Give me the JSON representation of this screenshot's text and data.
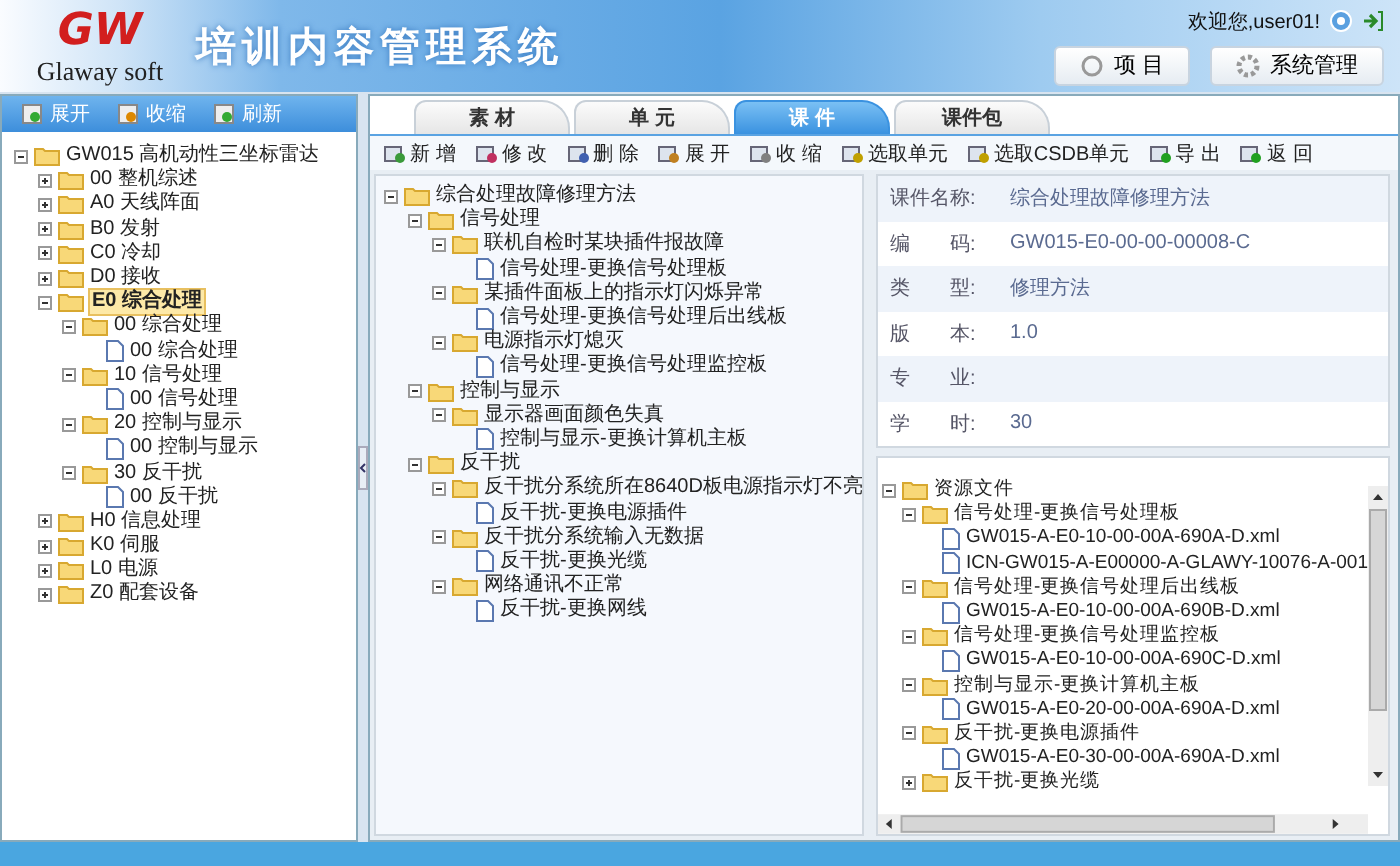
{
  "header": {
    "logo_mark": "GW",
    "logo_text": "Glaway soft",
    "title": "培训内容管理系统",
    "welcome": "欢迎您,user01!",
    "buttons": [
      "项 目",
      "系统管理"
    ]
  },
  "left_toolbar": [
    "展开",
    "收缩",
    "刷新"
  ],
  "left_tree": [
    {
      "label": "GW015 高机动性三坐标雷达",
      "kind": "folder",
      "expanded": true,
      "selected": false,
      "children": [
        {
          "label": "00 整机综述",
          "kind": "folder",
          "expanded": false,
          "selected": false
        },
        {
          "label": "A0 天线阵面",
          "kind": "folder",
          "expanded": false,
          "selected": false
        },
        {
          "label": "B0 发射",
          "kind": "folder",
          "expanded": false,
          "selected": false
        },
        {
          "label": "C0 冷却",
          "kind": "folder",
          "expanded": false,
          "selected": false
        },
        {
          "label": "D0 接收",
          "kind": "folder",
          "expanded": false,
          "selected": false
        },
        {
          "label": "E0 综合处理",
          "kind": "folder",
          "expanded": true,
          "selected": true,
          "children": [
            {
              "label": "00 综合处理",
              "kind": "folder",
              "expanded": true,
              "selected": false,
              "children": [
                {
                  "label": "00 综合处理",
                  "kind": "file",
                  "selected": false
                }
              ]
            },
            {
              "label": "10 信号处理",
              "kind": "folder",
              "expanded": true,
              "selected": false,
              "children": [
                {
                  "label": "00 信号处理",
                  "kind": "file",
                  "selected": false
                }
              ]
            },
            {
              "label": "20 控制与显示",
              "kind": "folder",
              "expanded": true,
              "selected": false,
              "children": [
                {
                  "label": "00 控制与显示",
                  "kind": "file",
                  "selected": false
                }
              ]
            },
            {
              "label": "30 反干扰",
              "kind": "folder",
              "expanded": true,
              "selected": false,
              "children": [
                {
                  "label": "00 反干扰",
                  "kind": "file",
                  "selected": false
                }
              ]
            }
          ]
        },
        {
          "label": "H0 信息处理",
          "kind": "folder",
          "expanded": false,
          "selected": false
        },
        {
          "label": "K0 伺服",
          "kind": "folder",
          "expanded": false,
          "selected": false
        },
        {
          "label": "L0 电源",
          "kind": "folder",
          "expanded": false,
          "selected": false
        },
        {
          "label": "Z0 配套设备",
          "kind": "folder",
          "expanded": false,
          "selected": false
        }
      ]
    }
  ],
  "tabs": [
    {
      "label": "素 材",
      "selected": false
    },
    {
      "label": "单 元",
      "selected": false
    },
    {
      "label": "课 件",
      "selected": true
    },
    {
      "label": "课件包",
      "selected": false
    }
  ],
  "toolbar": [
    "新 增",
    "修 改",
    "删 除",
    "展 开",
    "收 缩",
    "选取单元",
    "选取CSDB单元",
    "导 出",
    "返 回"
  ],
  "course_tree": [
    {
      "label": "综合处理故障修理方法",
      "kind": "folder",
      "expanded": true,
      "selected": false,
      "children": [
        {
          "label": "信号处理",
          "kind": "folder",
          "expanded": true,
          "selected": false,
          "children": [
            {
              "label": "联机自检时某块插件报故障",
              "kind": "folder",
              "expanded": true,
              "selected": false,
              "children": [
                {
                  "label": "信号处理-更换信号处理板",
                  "kind": "file",
                  "selected": false
                }
              ]
            },
            {
              "label": "某插件面板上的指示灯闪烁异常",
              "kind": "folder",
              "expanded": true,
              "selected": false,
              "children": [
                {
                  "label": "信号处理-更换信号处理后出线板",
                  "kind": "file",
                  "selected": false
                }
              ]
            },
            {
              "label": "电源指示灯熄灭",
              "kind": "folder",
              "expanded": true,
              "selected": false,
              "children": [
                {
                  "label": "信号处理-更换信号处理监控板",
                  "kind": "file",
                  "selected": false
                }
              ]
            }
          ]
        },
        {
          "label": "控制与显示",
          "kind": "folder",
          "expanded": true,
          "selected": false,
          "children": [
            {
              "label": "显示器画面颜色失真",
              "kind": "folder",
              "expanded": true,
              "selected": false,
              "children": [
                {
                  "label": "控制与显示-更换计算机主板",
                  "kind": "file",
                  "selected": false
                }
              ]
            }
          ]
        },
        {
          "label": "反干扰",
          "kind": "folder",
          "expanded": true,
          "selected": false,
          "children": [
            {
              "label": "反干扰分系统所在8640D板电源指示灯不亮",
              "kind": "folder",
              "expanded": true,
              "selected": false,
              "children": [
                {
                  "label": "反干扰-更换电源插件",
                  "kind": "file",
                  "selected": false
                }
              ]
            },
            {
              "label": "反干扰分系统输入无数据",
              "kind": "folder",
              "expanded": true,
              "selected": false,
              "children": [
                {
                  "label": "反干扰-更换光缆",
                  "kind": "file",
                  "selected": false
                }
              ]
            },
            {
              "label": "网络通讯不正常",
              "kind": "folder",
              "expanded": true,
              "selected": false,
              "children": [
                {
                  "label": "反干扰-更换网线",
                  "kind": "file",
                  "selected": false
                }
              ]
            }
          ]
        }
      ]
    }
  ],
  "details": [
    {
      "label": "课件名称:",
      "value": "综合处理故障修理方法"
    },
    {
      "label": "编　　码:",
      "value": "GW015-E0-00-00-00008-C"
    },
    {
      "label": "类　　型:",
      "value": "修理方法"
    },
    {
      "label": "版　　本:",
      "value": "1.0"
    },
    {
      "label": "专　　业:"
    },
    {
      "label": "学　　时:",
      "value": "30"
    }
  ],
  "resource_tree": [
    {
      "label": "资源文件",
      "kind": "folder",
      "expanded": true,
      "selected": false,
      "children": [
        {
          "label": "信号处理-更换信号处理板",
          "kind": "folder",
          "expanded": true,
          "selected": false,
          "children": [
            {
              "label": "GW015-A-E0-10-00-00A-690A-D.xml",
              "kind": "file",
              "selected": false
            },
            {
              "label": "ICN-GW015-A-E00000-A-GLAWY-10076-A-001",
              "kind": "file",
              "selected": false
            }
          ]
        },
        {
          "label": "信号处理-更换信号处理后出线板",
          "kind": "folder",
          "expanded": true,
          "selected": false,
          "children": [
            {
              "label": "GW015-A-E0-10-00-00A-690B-D.xml",
              "kind": "file",
              "selected": false
            }
          ]
        },
        {
          "label": "信号处理-更换信号处理监控板",
          "kind": "folder",
          "expanded": true,
          "selected": false,
          "children": [
            {
              "label": "GW015-A-E0-10-00-00A-690C-D.xml",
              "kind": "file",
              "selected": false
            }
          ]
        },
        {
          "label": "控制与显示-更换计算机主板",
          "kind": "folder",
          "expanded": true,
          "selected": false,
          "children": [
            {
              "label": "GW015-A-E0-20-00-00A-690A-D.xml",
              "kind": "file",
              "selected": false
            }
          ]
        },
        {
          "label": "反干扰-更换电源插件",
          "kind": "folder",
          "expanded": true,
          "selected": false,
          "children": [
            {
              "label": "GW015-A-E0-30-00-00A-690A-D.xml",
              "kind": "file",
              "selected": false
            }
          ]
        },
        {
          "label": "反干扰-更换光缆",
          "kind": "folder",
          "expanded": false,
          "selected": false
        }
      ]
    }
  ]
}
